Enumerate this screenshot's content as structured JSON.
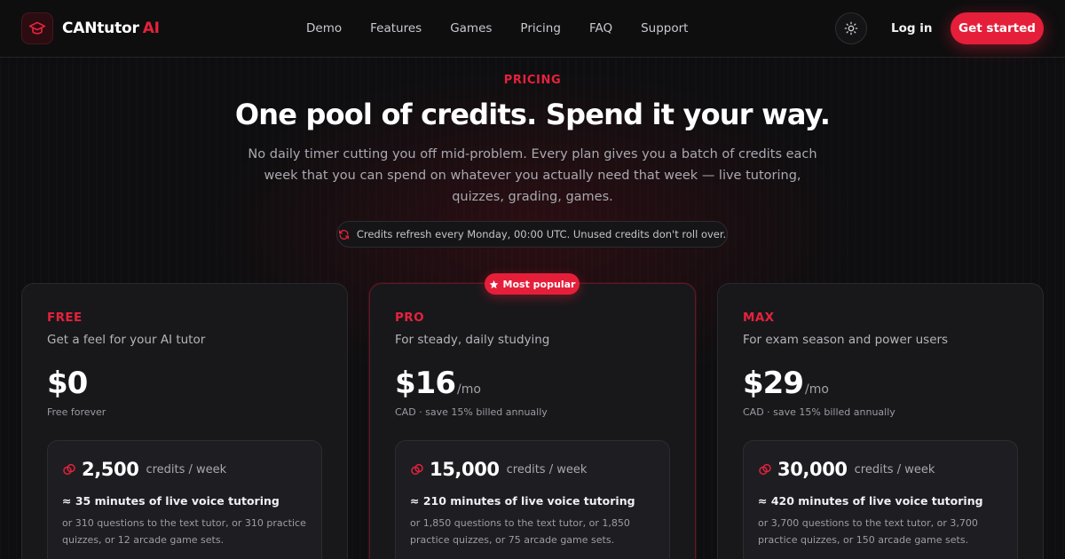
{
  "brand": {
    "name": "CANtutor",
    "suffix": "AI"
  },
  "nav": {
    "links": [
      "Demo",
      "Features",
      "Games",
      "Pricing",
      "FAQ",
      "Support"
    ]
  },
  "actions": {
    "login": "Log in",
    "cta": "Get started"
  },
  "icons": {
    "brand": "graduation-cap-icon",
    "theme": "sun-icon",
    "refresh": "refresh-icon",
    "star": "star-icon",
    "credits": "coins-icon"
  },
  "colors": {
    "accent": "#e51f3a",
    "background": "#0e0e10",
    "card": "#18181b"
  },
  "hero": {
    "eyebrow": "PRICING",
    "headline": "One pool of credits. Spend it your way.",
    "subtitle": "No daily timer cutting you off mid-problem. Every plan gives you a batch of credits each week that you can spend on whatever you actually need that week — live tutoring, quizzes, grading, games.",
    "refresh_note": "Credits refresh every Monday, 00:00 UTC. Unused credits don't roll over."
  },
  "popular_badge": "Most popular",
  "plans": [
    {
      "tier": "FREE",
      "tagline": "Get a feel for your AI tutor",
      "price": "$0",
      "period": "",
      "price_note": "Free forever",
      "credits": "2,500",
      "credits_unit": "credits / week",
      "equivalent": "≈ 35 minutes of live voice tutoring",
      "detail": "or 310 questions to the text tutor, or 310 practice quizzes, or 12 arcade game sets."
    },
    {
      "tier": "PRO",
      "tagline": "For steady, daily studying",
      "price": "$16",
      "period": "/mo",
      "price_note": "CAD · save 15% billed annually",
      "credits": "15,000",
      "credits_unit": "credits / week",
      "equivalent": "≈ 210 minutes of live voice tutoring",
      "detail": "or 1,850 questions to the text tutor, or 1,850 practice quizzes, or 75 arcade game sets."
    },
    {
      "tier": "MAX",
      "tagline": "For exam season and power users",
      "price": "$29",
      "period": "/mo",
      "price_note": "CAD · save 15% billed annually",
      "credits": "30,000",
      "credits_unit": "credits / week",
      "equivalent": "≈ 420 minutes of live voice tutoring",
      "detail": "or 3,700 questions to the text tutor, or 3,700 practice quizzes, or 150 arcade game sets."
    }
  ]
}
